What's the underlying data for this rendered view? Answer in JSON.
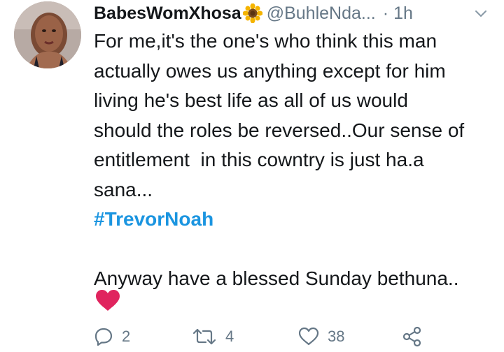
{
  "tweet": {
    "display_name": "BabesWomXhosa",
    "handle": "@BuhleNda...",
    "separator": "·",
    "time": "1h",
    "lines": [
      "For me,it's the one's who think this man",
      "actually owes us anything except for him",
      "living he's best life as all of us would",
      "should the roles be reversed..Our sense of",
      "entitlement  in this cowntry is just ha.a",
      "sana..."
    ],
    "hashtag": "#TrevorNoah",
    "closing_line": "Anyway have a blessed Sunday bethuna..",
    "emoji": "red-heart",
    "emoji_in_name": "sunflower"
  },
  "actions": {
    "reply_count": "2",
    "retweet_count": "4",
    "like_count": "38"
  },
  "colors": {
    "text": "#14171a",
    "muted": "#657786",
    "hashtag": "#1b95e0",
    "heart": "#e0245e"
  },
  "icons": [
    "chevron-down-icon",
    "reply-icon",
    "retweet-icon",
    "like-icon",
    "share-icon",
    "sunflower-icon",
    "heart-icon"
  ]
}
